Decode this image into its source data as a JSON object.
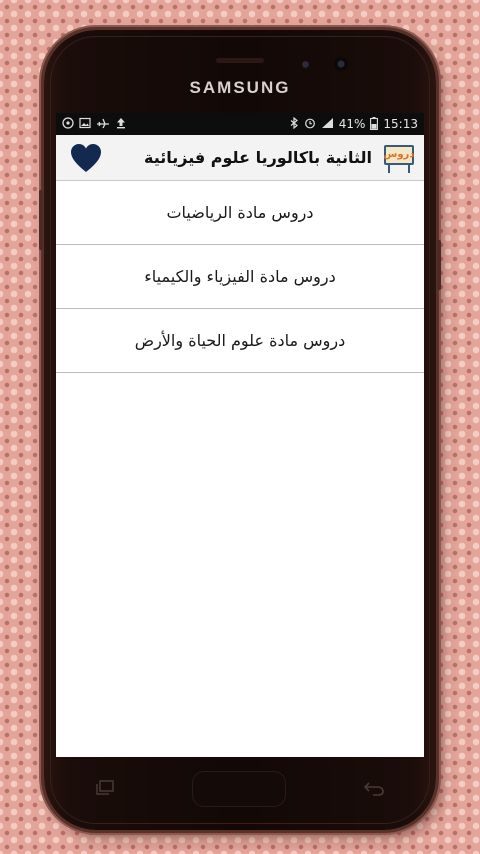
{
  "device": {
    "brand": "SAMSUNG"
  },
  "status_bar": {
    "left_icons": [
      "whatsapp-icon",
      "image-icon",
      "airplane-icon",
      "upload-icon"
    ],
    "battery_percent": "41%",
    "time": "15:13"
  },
  "app_bar": {
    "title": "الثانية باكالوريا علوم فيزيائية",
    "logo_text": "دروس"
  },
  "menu": {
    "items": [
      {
        "label": "دروس مادة الرياضيات"
      },
      {
        "label": "دروس مادة الفيزياء والكيمياء"
      },
      {
        "label": "دروس مادة علوم الحياة والأرض"
      }
    ]
  },
  "colors": {
    "heart": "#13294f",
    "logo_orange": "#d9721e",
    "background": "#e3a59a"
  }
}
